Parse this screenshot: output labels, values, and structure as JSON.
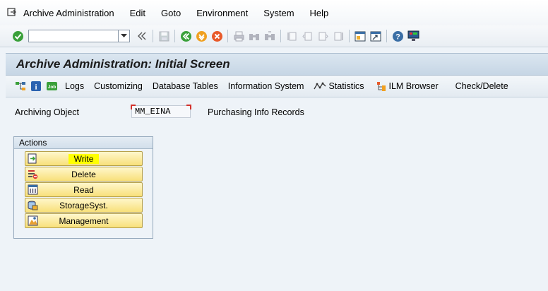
{
  "menu": {
    "items": [
      {
        "id": "archive",
        "label": "Archive Administration"
      },
      {
        "id": "edit",
        "label": "Edit"
      },
      {
        "id": "goto",
        "label": "Goto"
      },
      {
        "id": "environment",
        "label": "Environment"
      },
      {
        "id": "system",
        "label": "System"
      },
      {
        "id": "help",
        "label": "Help"
      }
    ]
  },
  "toolbar": {
    "command_value": "",
    "command_placeholder": ""
  },
  "title": "Archive Administration: Initial Screen",
  "app_toolbar": {
    "logs": "Logs",
    "customizing": "Customizing",
    "database_tables": "Database Tables",
    "information_system": "Information System",
    "statistics": "Statistics",
    "ilm_browser": "ILM Browser",
    "check_delete": "Check/Delete"
  },
  "form": {
    "archiving_object_label": "Archiving Object",
    "archiving_object_value": "MM_EINA",
    "archiving_object_desc": "Purchasing Info Records"
  },
  "actions": {
    "title": "Actions",
    "buttons": [
      {
        "id": "write",
        "label": "Write",
        "icon": "write-icon"
      },
      {
        "id": "delete",
        "label": "Delete",
        "icon": "delete-icon"
      },
      {
        "id": "read",
        "label": "Read",
        "icon": "read-icon"
      },
      {
        "id": "storage",
        "label": "StorageSyst.",
        "icon": "storage-icon"
      },
      {
        "id": "management",
        "label": "Management",
        "icon": "management-icon"
      }
    ]
  },
  "colors": {
    "accent_green": "#3aa03a",
    "required_marker": "#d3302b",
    "action_button": "#f8e07a",
    "highlight": "#ffff00"
  }
}
